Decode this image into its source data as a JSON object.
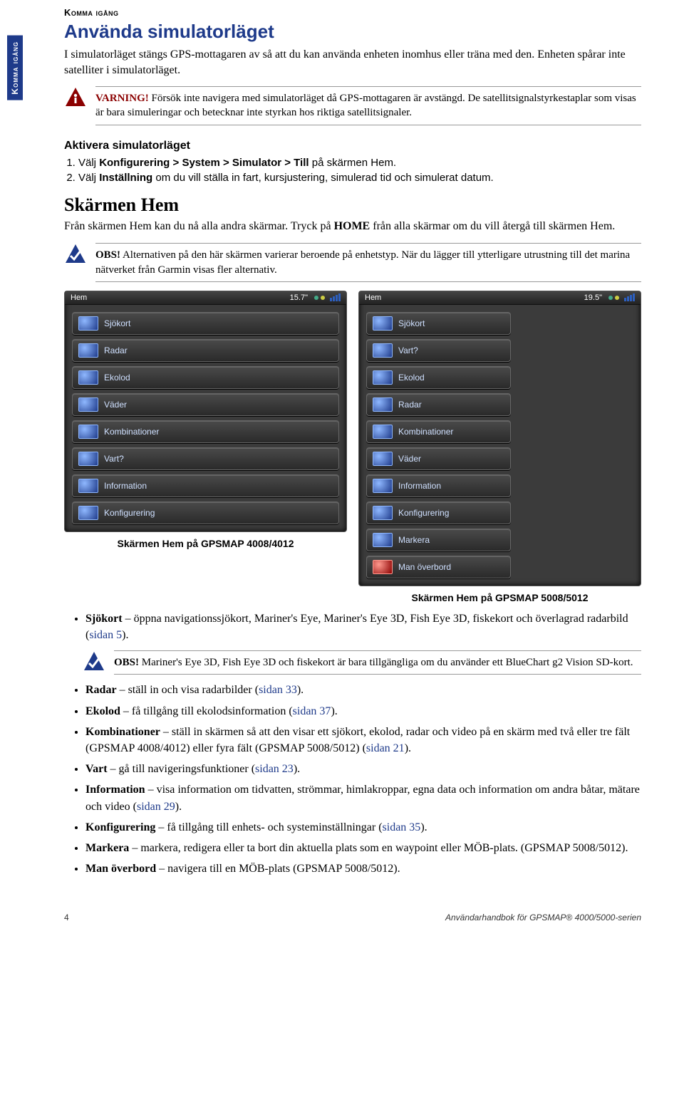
{
  "sideTab": "Komma igång",
  "breadcrumb": "Komma igång",
  "section1": {
    "title": "Använda simulatorläget",
    "intro": "I simulatorläget stängs GPS-mottagaren av så att du kan använda enheten inomhus eller träna med den. Enheten spårar inte satelliter i simulatorläget.",
    "warningLead": "VARNING!",
    "warningBody": " Försök inte navigera med simulatorläget då GPS-mottagaren är avstängd. De satellitsignalstyrkestaplar som visas är bara simuleringar och betecknar inte styrkan hos riktiga satellitsignaler.",
    "activateTitle": "Aktivera simulatorläget",
    "step1_prefix": "Välj ",
    "step1_path": "Konfigurering > System > Simulator > Till",
    "step1_suffix": " på skärmen Hem.",
    "step2_prefix": "Välj ",
    "step2_bold": "Inställning",
    "step2_suffix": " om du vill ställa in fart, kursjustering, simulerad tid och simulerat datum."
  },
  "section2": {
    "title": "Skärmen Hem",
    "intro1": "Från skärmen Hem kan du nå alla andra skärmar. Tryck på ",
    "introBold": "HOME",
    "intro2": " från alla skärmar om du vill återgå till skärmen Hem.",
    "obsLead": "OBS!",
    "obsBody": " Alternativen på den här skärmen varierar beroende på enhetstyp. När du lägger till ytterligare utrustning till det marina nätverket från Garmin visas fler alternativ."
  },
  "shots": {
    "left": {
      "hemLabel": "Hem",
      "size": "15.7\"",
      "items": [
        "Sjökort",
        "Radar",
        "Ekolod",
        "Väder",
        "Kombinationer",
        "Vart?",
        "Information",
        "Konfigurering"
      ],
      "caption": "Skärmen Hem på GPSMAP 4008/4012"
    },
    "right": {
      "hemLabel": "Hem",
      "size": "19.5\"",
      "items": [
        "Sjökort",
        "Vart?",
        "Ekolod",
        "Radar",
        "Kombinationer",
        "Väder",
        "Information",
        "Konfigurering",
        "Markera",
        "Man överbord"
      ],
      "caption": "Skärmen Hem på GPSMAP 5008/5012"
    }
  },
  "bullets": {
    "sjokort_label": "Sjökort",
    "sjokort_body": " – öppna navigationssjökort, Mariner's Eye, Mariner's Eye 3D, Fish Eye 3D, fiskekort och överlagrad radarbild (",
    "sjokort_link": "sidan 5",
    "sjokort_close": ").",
    "obsLead": "OBS!",
    "obsBody": " Mariner's Eye 3D, Fish Eye 3D och fiskekort är bara tillgängliga om du använder ett BlueChart g2 Vision SD-kort.",
    "radar_label": "Radar",
    "radar_body": " – ställ in och visa radarbilder (",
    "radar_link": "sidan 33",
    "radar_close": ").",
    "ekolod_label": "Ekolod",
    "ekolod_body": " – få tillgång till ekolodsinformation (",
    "ekolod_link": "sidan 37",
    "ekolod_close": ").",
    "kombo_label": "Kombinationer",
    "kombo_body": " – ställ in skärmen så att den visar ett sjökort, ekolod, radar och video på en skärm med två eller tre fält (GPSMAP 4008/4012) eller fyra fält (GPSMAP 5008/5012) (",
    "kombo_link": "sidan 21",
    "kombo_close": ").",
    "vart_label": "Vart",
    "vart_body": " – gå till navigeringsfunktioner (",
    "vart_link": "sidan 23",
    "vart_close": ").",
    "info_label": "Information",
    "info_body": " – visa information om tidvatten, strömmar, himlakroppar, egna data och information om andra båtar, mätare och video (",
    "info_link": "sidan 29",
    "info_close": ").",
    "konf_label": "Konfigurering",
    "konf_body": " – få tillgång till enhets- och systeminställningar (",
    "konf_link": "sidan 35",
    "konf_close": ").",
    "mark_label": "Markera",
    "mark_body": " – markera, redigera eller ta bort din aktuella plats som en waypoint eller MÖB-plats. (GPSMAP 5008/5012).",
    "mob_label": "Man överbord",
    "mob_body": " – navigera till en MÖB-plats (GPSMAP 5008/5012)."
  },
  "footer": {
    "page": "4",
    "right": "Användarhandbok för GPSMAP® 4000/5000-serien"
  }
}
